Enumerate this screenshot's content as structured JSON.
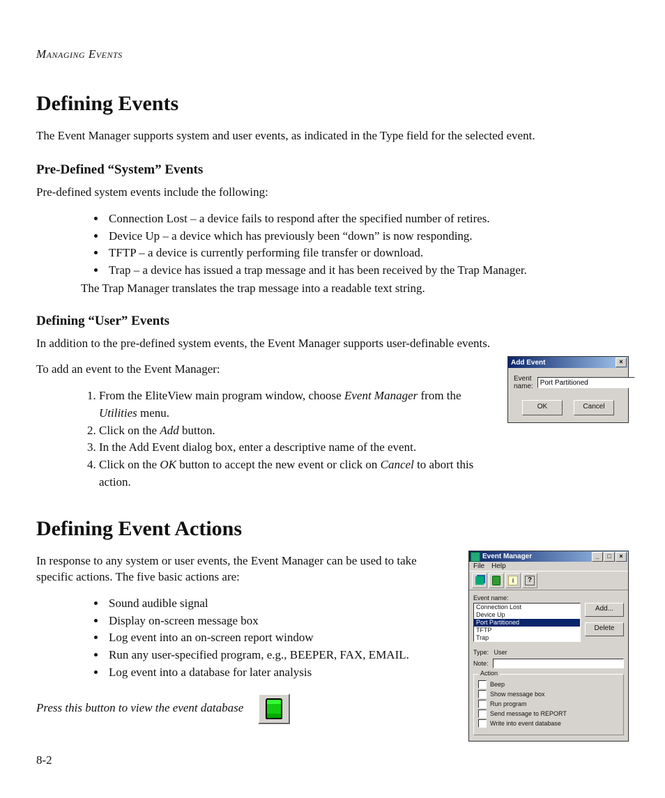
{
  "running_head": "Managing Events",
  "section1": {
    "title": "Defining Events",
    "intro": "The Event Manager supports system and user events, as indicated in the Type field for the selected event.",
    "sub1": {
      "title": "Pre-Defined “System” Events",
      "lead": "Pre-defined system events include the following:",
      "bullets": [
        "Connection Lost – a device fails to respond after the specified number of retires.",
        "Device Up – a device which has previously been “down” is now responding.",
        "TFTP – a device is currently performing file transfer or download.",
        "Trap – a device has issued a trap message and it has been received by the Trap Manager."
      ],
      "tail": "The Trap Manager translates the trap message into a readable text string."
    },
    "sub2": {
      "title": "Defining “User” Events",
      "lead": "In addition to the pre-defined system events, the Event Manager supports user-definable events.",
      "lead2": "To add an event to the Event Manager:",
      "steps": {
        "s1a": "From the EliteView main program window, choose ",
        "s1i1": "Event Manager",
        "s1b": " from the ",
        "s1i2": "Utilities",
        "s1c": " menu.",
        "s2a": "Click on the ",
        "s2i": "Add",
        "s2b": " button.",
        "s3": "In the Add Event dialog box, enter a descriptive name of the event.",
        "s4a": "Click on the ",
        "s4i1": "OK",
        "s4b": " button to accept the new event or click on ",
        "s4i2": "Cancel",
        "s4c": " to abort this action."
      }
    }
  },
  "section2": {
    "title": "Defining Event Actions",
    "intro": "In response to any system or user events, the Event Manager can be used to take specific actions. The five basic actions are:",
    "bullets": [
      "Sound audible signal",
      "Display on-screen message box",
      "Log event into an on-screen report window",
      "Run any user-specified program, e.g., BEEPER, FAX, EMAIL.",
      "Log event into a database for later analysis"
    ],
    "caption": "Press this button to view the event database"
  },
  "add_event_dialog": {
    "title": "Add Event",
    "close_glyph": "×",
    "field_label": "Event name:",
    "field_value": "Port Partitioned",
    "ok": "OK",
    "cancel": "Cancel"
  },
  "event_manager_window": {
    "title": "Event Manager",
    "min_glyph": "_",
    "max_glyph": "□",
    "close_glyph": "×",
    "menu": {
      "file": "File",
      "help": "Help"
    },
    "i_glyph": "i",
    "q_glyph": "?",
    "list_label": "Event name:",
    "list": [
      "Connection Lost",
      "Device Up",
      "Port Partitioned",
      "TFTP",
      "Trap"
    ],
    "selected_index": 2,
    "btn_add": "Add...",
    "btn_delete": "Delete",
    "type_label": "Type:",
    "type_value": "User",
    "note_label": "Note:",
    "note_value": "",
    "action_legend": "Action",
    "checks": [
      "Beep",
      "Show message box",
      "Run program",
      "Send message to REPORT",
      "Write into event database"
    ]
  },
  "page_number": "8-2"
}
